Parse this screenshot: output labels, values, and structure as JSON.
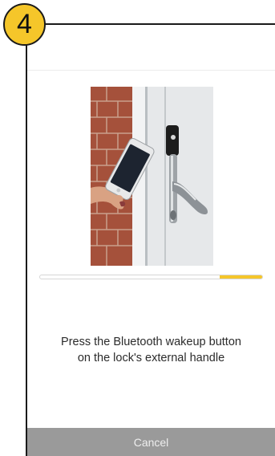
{
  "step": {
    "number": "4"
  },
  "photo": {
    "subject": "hand holding phone near a door lock handle"
  },
  "progress": {
    "segment_start": 0.81,
    "segment_end": 1.0,
    "color": "#f5c62a"
  },
  "instruction": {
    "line1": "Press the Bluetooth wakeup button",
    "line2": "on the lock's external handle"
  },
  "footer": {
    "cancel_label": "Cancel"
  },
  "colors": {
    "accent": "#f5c62a",
    "footer_bg": "#9a9a9a",
    "text": "#2b2b2b"
  }
}
